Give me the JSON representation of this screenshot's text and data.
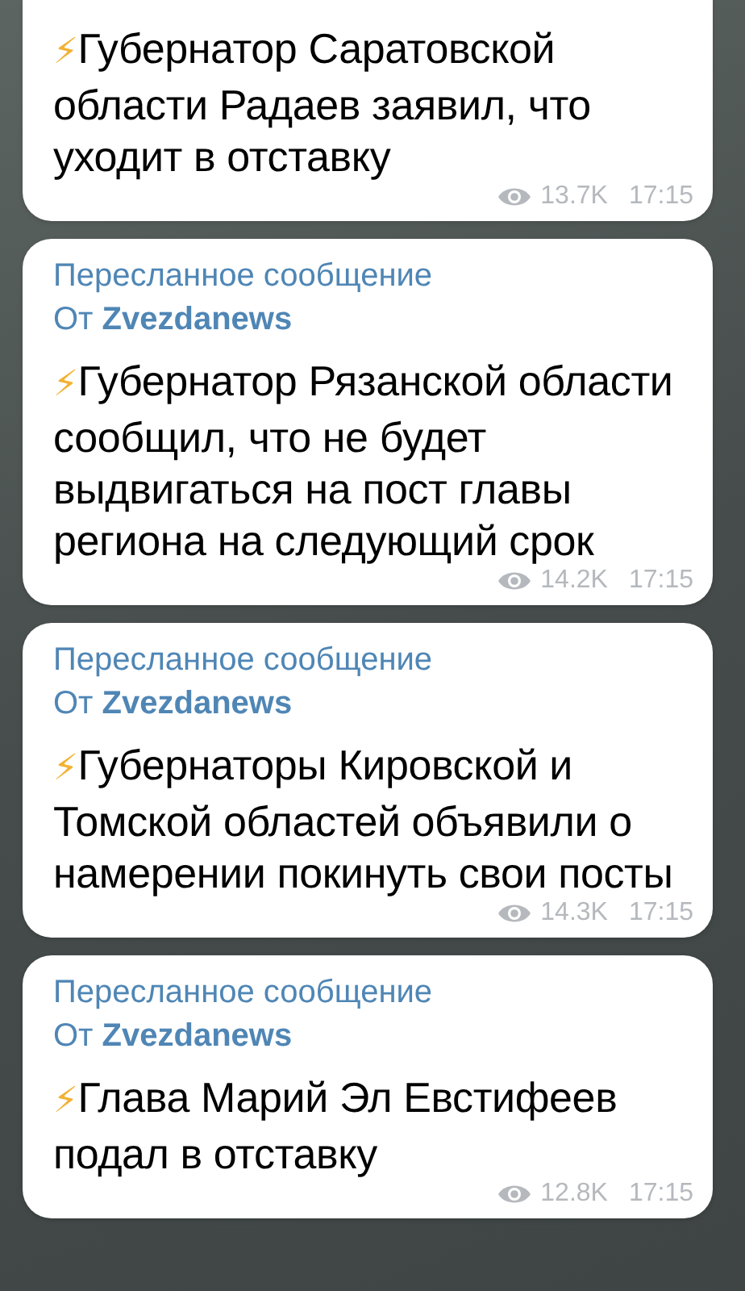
{
  "messages": [
    {
      "text": "⚡Губернатор Саратовской области Радаев заявил, что уходит в отставку",
      "views": "13.7K",
      "time": "17:15"
    },
    {
      "forwarded_label": "Пересланное сообщение",
      "forwarded_from": "От **Zvezdanews**",
      "text": "⚡Губернатор Рязанской области сообщил, что не будет выдвигаться на пост главы региона на следующий срок",
      "views": "14.2K",
      "time": "17:15"
    },
    {
      "forwarded_label": "Пересланное сообщение",
      "forwarded_from": "От **Zvezdanews**",
      "text": "⚡Губернаторы Кировской и Томской областей объявили о намерении покинуть свои посты",
      "views": "14.3K",
      "time": "17:15"
    },
    {
      "forwarded_label": "Пересланное сообщение",
      "forwarded_from": "От **Zvezdanews**",
      "text": "⚡Глава Марий Эл Евстифеев подал в отставку",
      "views": "12.8K",
      "time": "17:15"
    }
  ]
}
